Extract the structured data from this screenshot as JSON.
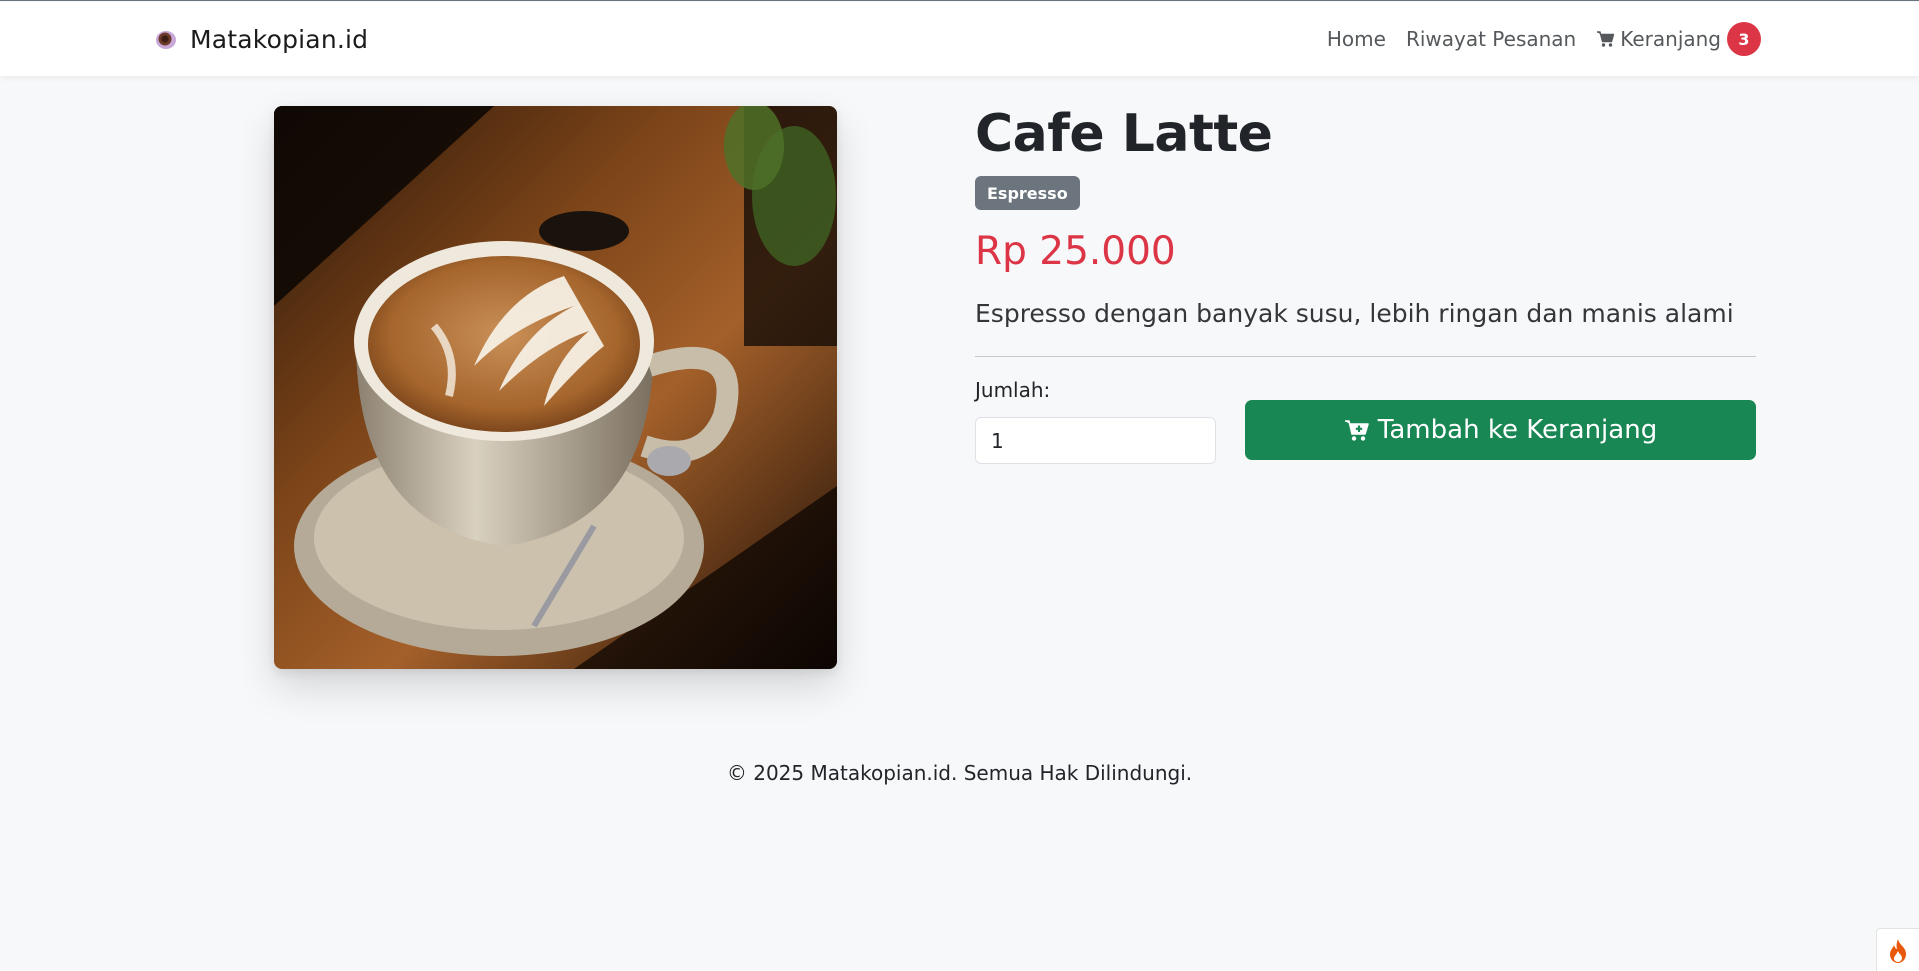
{
  "navbar": {
    "brand_name": "Matakopian.id",
    "brand_icon": "coffee-cup-icon",
    "links": {
      "home": "Home",
      "history": "Riwayat Pesanan",
      "cart": "Keranjang"
    },
    "cart_count": "3",
    "cart_icon": "shopping-cart-icon"
  },
  "product": {
    "name": "Cafe Latte",
    "category": "Espresso",
    "price": "Rp 25.000",
    "description": "Espresso dengan banyak susu, lebih ringan dan manis alami",
    "image_subject": "latte-art-coffee-cup"
  },
  "purchase": {
    "quantity_label": "Jumlah:",
    "quantity_value": "1",
    "add_button_label": "Tambah ke Keranjang",
    "add_button_icon": "cart-plus-icon"
  },
  "footer": {
    "copyright": "© 2025 Matakopian.id. Semua Hak Dilindungi."
  },
  "corner_widget": {
    "icon": "flame-icon"
  },
  "colors": {
    "page_bg": "#f7f8fa",
    "price": "#dc3545",
    "badge_bg": "#6c757d",
    "cart_badge": "#dc3545",
    "primary_button": "#198754"
  }
}
